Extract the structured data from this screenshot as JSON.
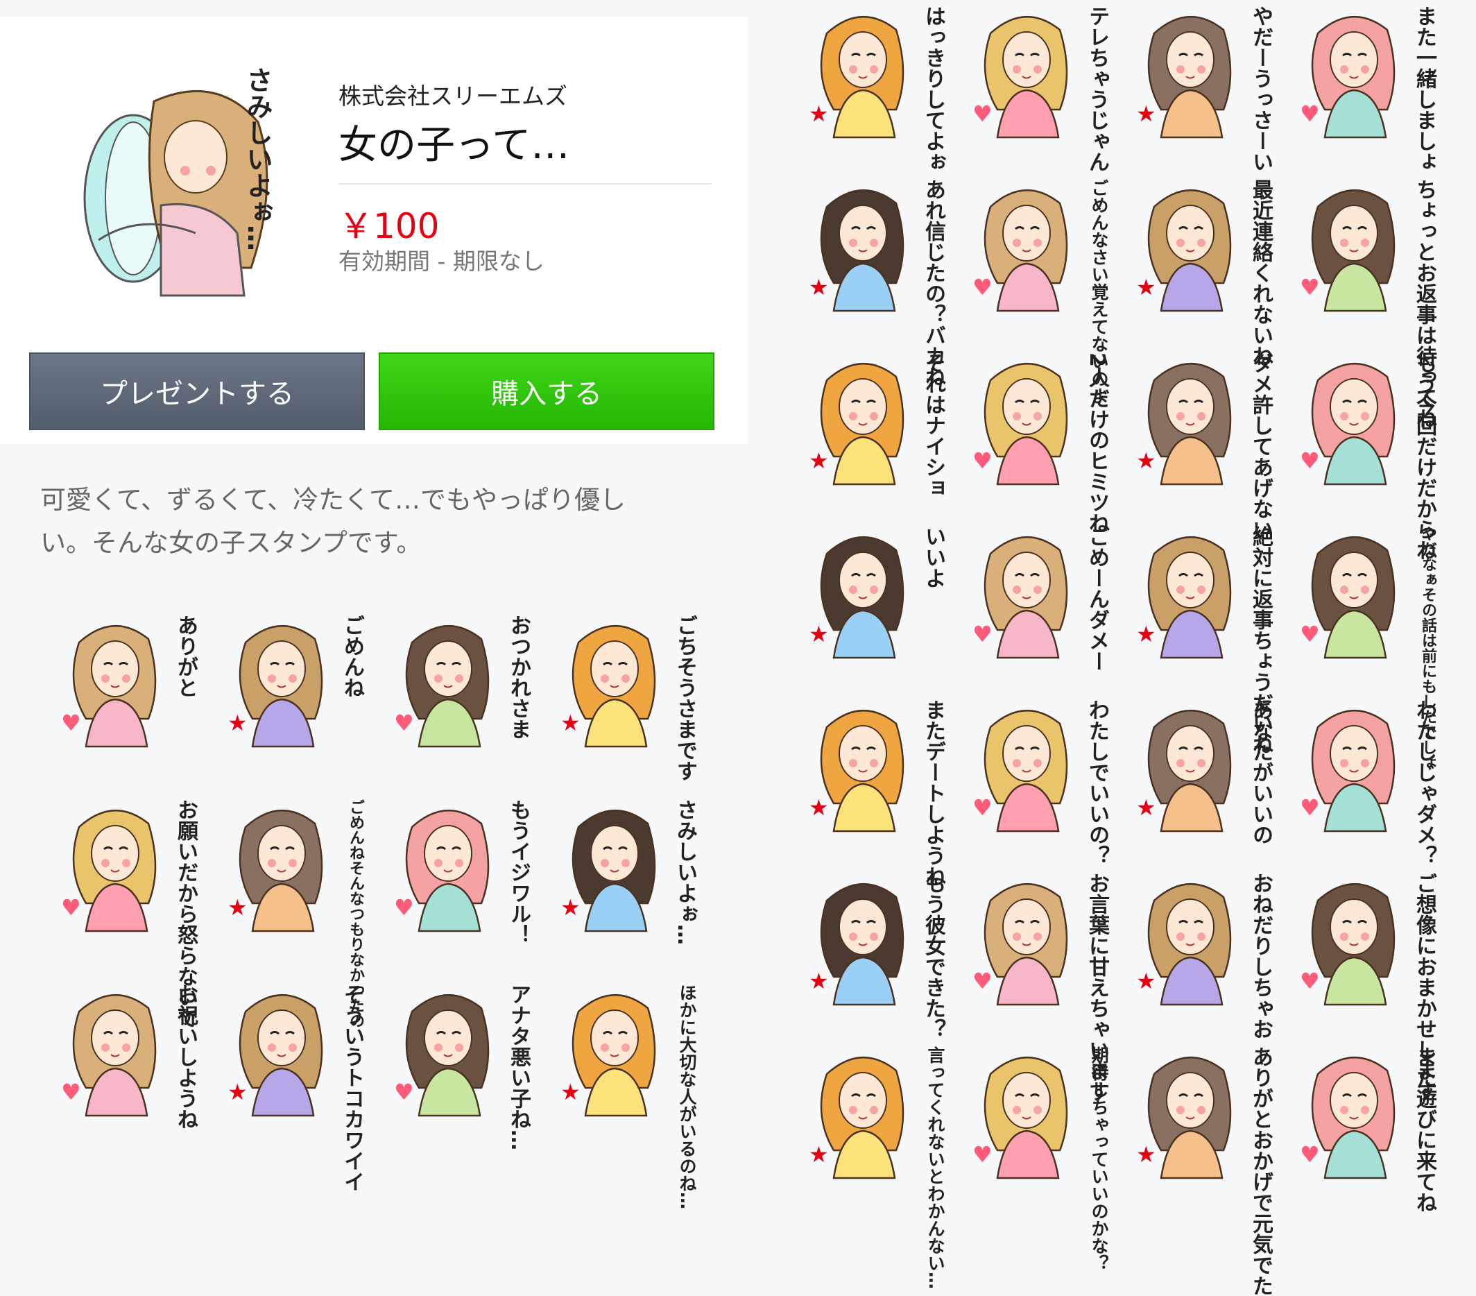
{
  "product": {
    "publisher": "株式会社スリーエムズ",
    "title": "女の子って…",
    "price": "￥100",
    "validity": "有効期間 - 期限なし",
    "main_sticker_text": "さみしいよぉ…"
  },
  "buttons": {
    "gift": "プレゼントする",
    "buy": "購入する"
  },
  "description": "可愛くて、ずるくて、冷たくて…でもやっぱり優しい。そんな女の子スタンプです。",
  "stickers_left": [
    "ありがと",
    "ごめんね",
    "おつかれさま",
    "ごちそうさまです",
    "お願いだから怒らないで",
    "ごめんねそんなつもりなかったの",
    "もうイジワル！",
    "さみしいよぉ…",
    "お祝いしようね",
    "そういうトコカワイイ",
    "アナタ悪い子ね…",
    "ほかに大切な人がいるのね…"
  ],
  "stickers_right": [
    "はっきりしてよぉ",
    "テレちゃうじゃん",
    "やだーうっさーい",
    "また一緒しましょ",
    "あれ信じたの？バカね",
    "ごめんなさい覚えてないのよ",
    "最近連絡くれないね",
    "ちょっとお返事は待ってね",
    "それはナイショ",
    "2人だけのヒミツね",
    "ダメ許してあげない",
    "もう今回だけだからね",
    "いいよ",
    "ごめーんダメー",
    "絶対に返事ちょうだいね",
    "やだなぁその話は前にもしたでしょ",
    "またデートしようね",
    "わたしでいいの？",
    "あなたがいいの",
    "わたしじゃダメ？",
    "もう彼女できた？",
    "お言葉に甘えちゃいます",
    "おねだりしちゃお",
    "ご想像におまかせします",
    "言ってくれないとわかんない…",
    "期待しちゃっていいのかな？",
    "ありがとおかげで元気でた",
    "また遊びに来てね"
  ],
  "colors": {
    "price": "#e60012",
    "buy_button": "#2fc70d",
    "gift_button": "#5f6977",
    "background": "#f7f8fa"
  },
  "icons": [
    "heart-icon",
    "star-icon",
    "pillow-icon"
  ]
}
